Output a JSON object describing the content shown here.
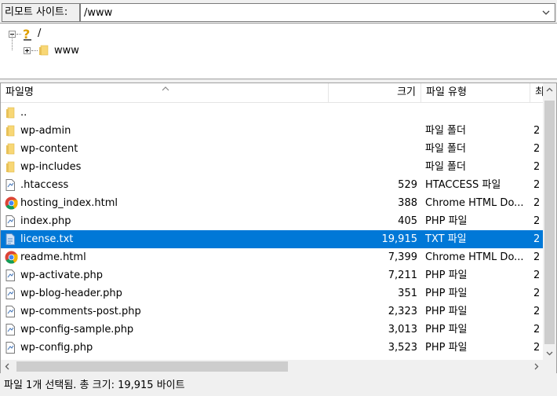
{
  "site_bar": {
    "label": "리모트 사이트:",
    "path": "/www"
  },
  "tree": {
    "root_label": "/",
    "child_label": "www"
  },
  "columns": {
    "name": "파일명",
    "size": "크기",
    "type": "파일 유형",
    "date": "최"
  },
  "files": [
    {
      "name": "..",
      "size": "",
      "type": "",
      "date": "",
      "icon": "folder-icon"
    },
    {
      "name": "wp-admin",
      "size": "",
      "type": "파일 폴더",
      "date": "2",
      "icon": "folder-icon"
    },
    {
      "name": "wp-content",
      "size": "",
      "type": "파일 폴더",
      "date": "2",
      "icon": "folder-icon"
    },
    {
      "name": "wp-includes",
      "size": "",
      "type": "파일 폴더",
      "date": "2",
      "icon": "folder-icon"
    },
    {
      "name": ".htaccess",
      "size": "529",
      "type": "HTACCESS 파일",
      "date": "2",
      "icon": "file-icon"
    },
    {
      "name": "hosting_index.html",
      "size": "388",
      "type": "Chrome HTML Do...",
      "date": "2",
      "icon": "chrome-icon"
    },
    {
      "name": "index.php",
      "size": "405",
      "type": "PHP 파일",
      "date": "2",
      "icon": "file-icon"
    },
    {
      "name": "license.txt",
      "size": "19,915",
      "type": "TXT 파일",
      "date": "2",
      "icon": "text-file-icon",
      "selected": true
    },
    {
      "name": "readme.html",
      "size": "7,399",
      "type": "Chrome HTML Do...",
      "date": "2",
      "icon": "chrome-icon"
    },
    {
      "name": "wp-activate.php",
      "size": "7,211",
      "type": "PHP 파일",
      "date": "2",
      "icon": "file-icon"
    },
    {
      "name": "wp-blog-header.php",
      "size": "351",
      "type": "PHP 파일",
      "date": "2",
      "icon": "file-icon"
    },
    {
      "name": "wp-comments-post.php",
      "size": "2,323",
      "type": "PHP 파일",
      "date": "2",
      "icon": "file-icon"
    },
    {
      "name": "wp-config-sample.php",
      "size": "3,013",
      "type": "PHP 파일",
      "date": "2",
      "icon": "file-icon"
    },
    {
      "name": "wp-config.php",
      "size": "3,523",
      "type": "PHP 파일",
      "date": "2",
      "icon": "file-icon"
    }
  ],
  "status": "파일 1개 선택됨. 총 크기: 19,915 바이트",
  "colors": {
    "selection": "#0078d7",
    "folder": "#f8d775",
    "scroll_thumb": "#cdcdcd"
  }
}
